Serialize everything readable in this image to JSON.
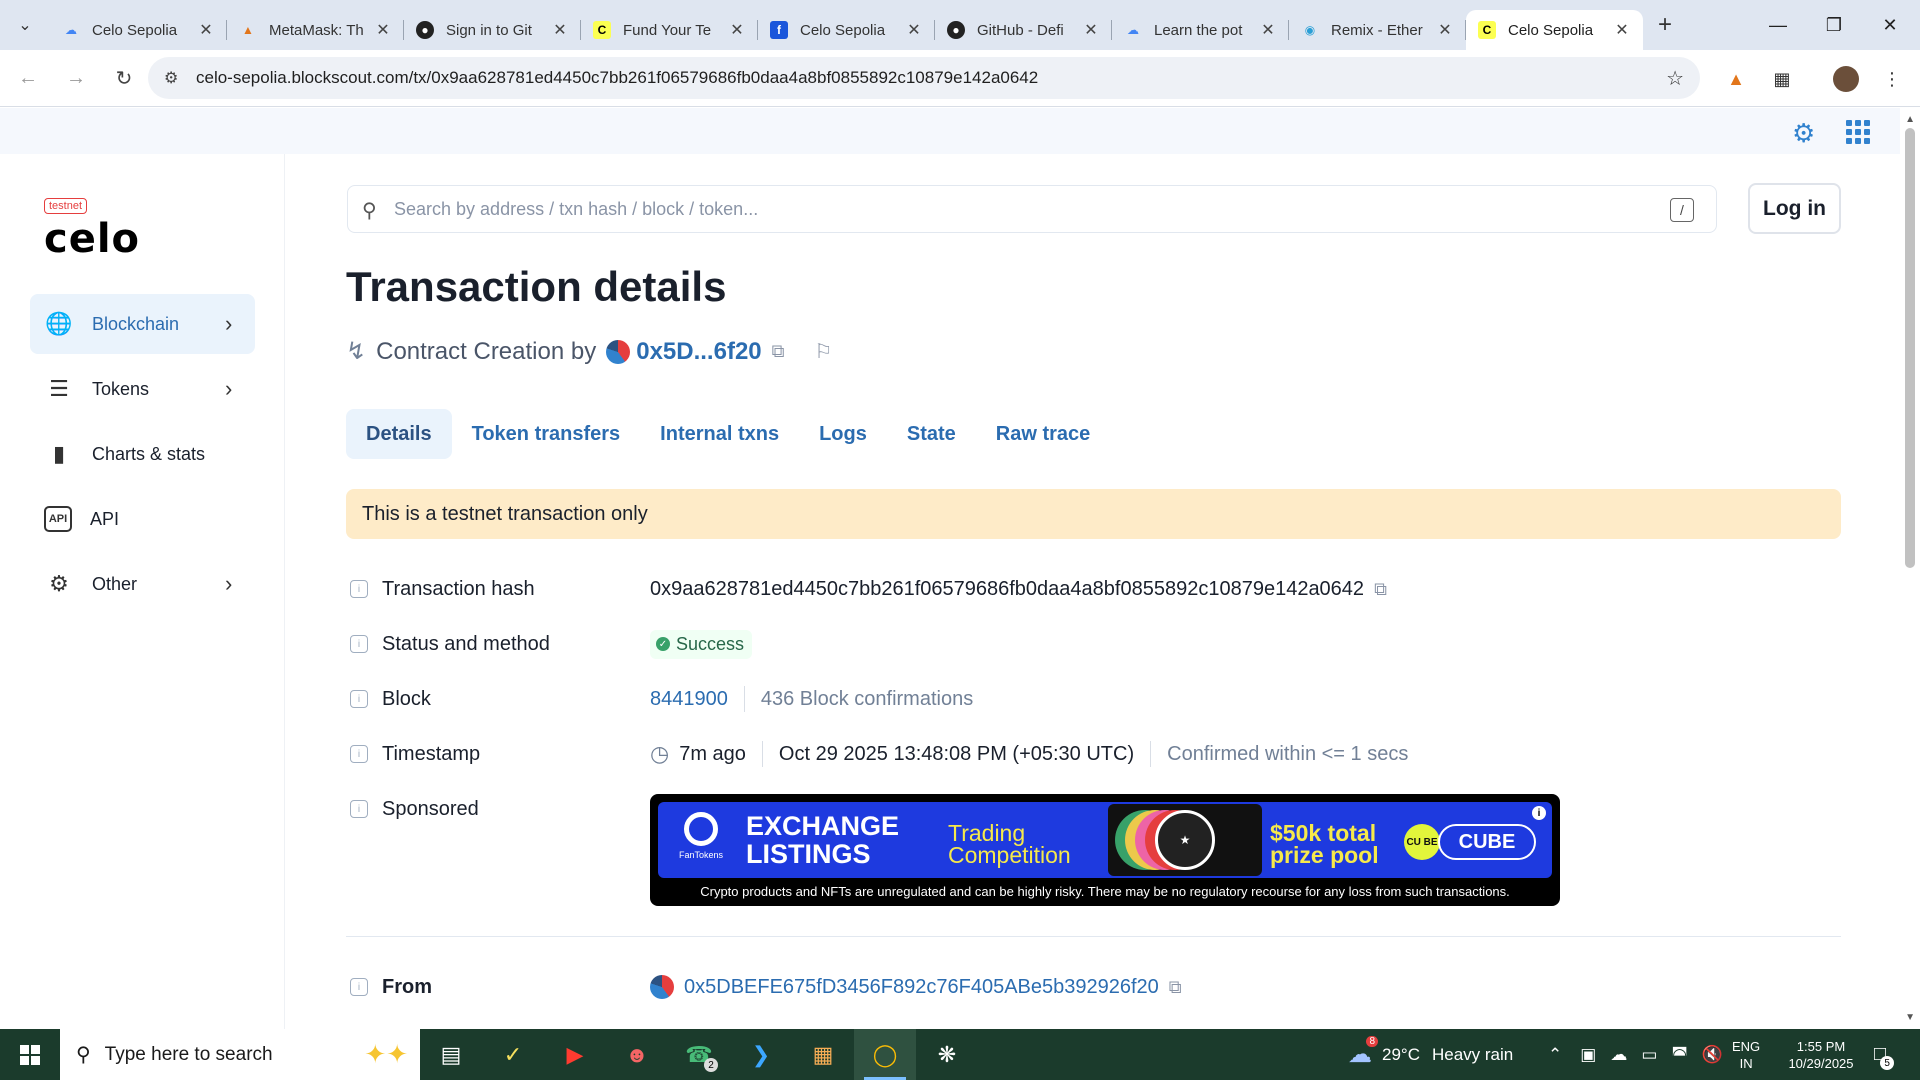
{
  "browser": {
    "tabs": [
      {
        "title": "Celo Sepolia",
        "icon": "google-cloud-icon",
        "active": false
      },
      {
        "title": "MetaMask: Th",
        "icon": "metamask-icon",
        "active": false
      },
      {
        "title": "Sign in to Git",
        "icon": "github-icon",
        "active": false
      },
      {
        "title": "Fund Your Te",
        "icon": "celo-icon",
        "active": false
      },
      {
        "title": "Celo Sepolia",
        "icon": "celo-docs-icon",
        "active": false
      },
      {
        "title": "GitHub - Defi",
        "icon": "github-icon",
        "active": false
      },
      {
        "title": "Learn the pot",
        "icon": "google-cloud-icon",
        "active": false
      },
      {
        "title": "Remix - Ether",
        "icon": "remix-icon",
        "active": false
      },
      {
        "title": "Celo Sepolia",
        "icon": "celo-icon",
        "active": true
      }
    ],
    "url": "celo-sepolia.blockscout.com/tx/0x9aa628781ed4450c7bb261f06579686fb0daa4a8bf0855892c10879e142a0642"
  },
  "sidebar": {
    "logo_badge": "testnet",
    "logo_text": "celo",
    "items": [
      {
        "label": "Blockchain",
        "icon": "globe-icon",
        "has_chevron": true,
        "active": true
      },
      {
        "label": "Tokens",
        "icon": "coins-stack-icon",
        "has_chevron": true,
        "active": false
      },
      {
        "label": "Charts & stats",
        "icon": "bar-chart-icon",
        "has_chevron": false,
        "active": false
      },
      {
        "label": "API",
        "icon": "api-icon",
        "has_chevron": false,
        "active": false
      },
      {
        "label": "Other",
        "icon": "gear-icon",
        "has_chevron": true,
        "active": false
      }
    ]
  },
  "search": {
    "placeholder": "Search by address / txn hash / block / token...",
    "shortcut": "/"
  },
  "header": {
    "login_label": "Log in"
  },
  "page": {
    "title": "Transaction details",
    "subtitle_prefix": "Contract Creation by",
    "creator_short": "0x5D...6f20"
  },
  "tabs": [
    "Details",
    "Token transfers",
    "Internal txns",
    "Logs",
    "State",
    "Raw trace"
  ],
  "alert": "This is a testnet transaction only",
  "details": {
    "hash_label": "Transaction hash",
    "hash_value": "0x9aa628781ed4450c7bb261f06579686fb0daa4a8bf0855892c10879e142a0642",
    "status_label": "Status and method",
    "status_value": "Success",
    "block_label": "Block",
    "block_value": "8441900",
    "block_confirmations": "436 Block confirmations",
    "timestamp_label": "Timestamp",
    "timestamp_ago": "7m ago",
    "timestamp_full": "Oct 29 2025 13:48:08 PM (+05:30 UTC)",
    "timestamp_confirmed": "Confirmed within <= 1 secs",
    "sponsored_label": "Sponsored",
    "from_label": "From",
    "from_value": "0x5DBEFE675fD3456F892c76F405ABe5b392926f20"
  },
  "banner": {
    "brand_small": "FanTokens",
    "headline_1": "EXCHANGE",
    "headline_2": "LISTINGS",
    "trading_1": "Trading",
    "trading_2": "Competition",
    "prize_1": "$50k total",
    "prize_2": "prize pool",
    "cube_icon": "CU BE",
    "cube_label": "CUBE",
    "disclaimer": "Crypto products and NFTs are unregulated and can be highly risky. There may be no regulatory recourse for any loss from such transactions."
  },
  "taskbar": {
    "search_placeholder": "Type here to search",
    "whatsapp_badge": "2",
    "weather_badge": "8",
    "weather_temp": "29°C",
    "weather_desc": "Heavy rain",
    "lang_1": "ENG",
    "lang_2": "IN",
    "time": "1:55 PM",
    "date": "10/29/2025",
    "notif_count": "5"
  },
  "colors": {
    "link": "#2b6cb0",
    "alert_bg": "#feebc8",
    "success": "#38a169",
    "tab_active_bg": "#eaf3fc",
    "taskbar_bg": "#1b3b2c"
  }
}
